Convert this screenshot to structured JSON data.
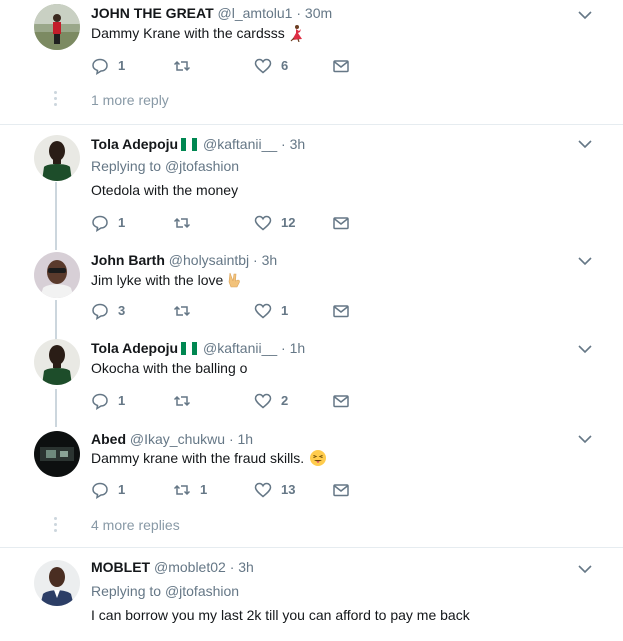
{
  "tweets": [
    {
      "name": "JOHN THE GREAT",
      "handle": "@l_amtolu1",
      "time": "30m",
      "replying_label": "",
      "replying_to": "",
      "text": "Dammy Krane with the cardsss",
      "emoji": "dancer-emoji",
      "flag": false,
      "replies": "1",
      "retweets": "",
      "likes": "6"
    },
    {
      "name": "Tola Adepoju",
      "handle": "@kaftanii__",
      "time": "3h",
      "replying_label": "Replying to",
      "replying_to": "@jtofashion",
      "text": "Otedola with the money",
      "emoji": "",
      "flag": true,
      "replies": "1",
      "retweets": "",
      "likes": "12"
    },
    {
      "name": "John Barth",
      "handle": "@holysaintbj",
      "time": "3h",
      "replying_label": "",
      "replying_to": "",
      "text": "Jim lyke with the love",
      "emoji": "victory-hand-emoji",
      "flag": false,
      "replies": "3",
      "retweets": "",
      "likes": "1"
    },
    {
      "name": "Tola Adepoju",
      "handle": "@kaftanii__",
      "time": "1h",
      "replying_label": "",
      "replying_to": "",
      "text": "Okocha with the balling o",
      "emoji": "",
      "flag": true,
      "replies": "1",
      "retweets": "",
      "likes": "2"
    },
    {
      "name": "Abed",
      "handle": "@Ikay_chukwu",
      "time": "1h",
      "replying_label": "",
      "replying_to": "",
      "text": "Dammy krane with the fraud skills.",
      "emoji": "tongue-wink-emoji",
      "flag": false,
      "replies": "1",
      "retweets": "1",
      "likes": "13"
    },
    {
      "name": "MOBLET",
      "handle": "@moblet02",
      "time": "3h",
      "replying_label": "Replying to",
      "replying_to": "@jtofashion",
      "text": "I can borrow you my last 2k till you can afford to pay me back",
      "emoji": "",
      "flag": false,
      "replies": "",
      "retweets": "",
      "likes": ""
    }
  ],
  "more_links": {
    "first": "1 more reply",
    "second": "4 more replies"
  },
  "separator": "·",
  "colors": {
    "secondary_text": "#657786",
    "icon": "#657786",
    "divider": "#e6ecf0",
    "thread_line": "#ccd6dd",
    "flag_green": "#008751"
  },
  "icons": {
    "reply": "reply-icon",
    "retweet": "retweet-icon",
    "like": "heart-icon",
    "message": "envelope-icon",
    "menu": "chevron-down-icon"
  }
}
